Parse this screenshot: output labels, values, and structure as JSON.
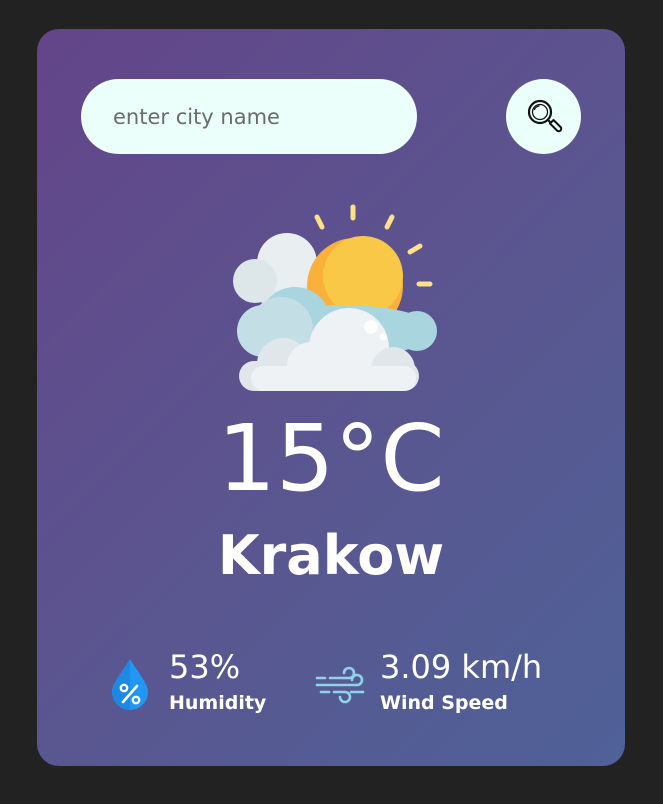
{
  "search": {
    "placeholder": "enter city name",
    "value": "",
    "button_icon": "magnifier-icon"
  },
  "weather": {
    "icon": "partly-cloudy-icon",
    "temperature": "15°C",
    "city": "Krakow"
  },
  "details": {
    "humidity": {
      "icon": "humidity-drop-icon",
      "value": "53%",
      "label": "Humidity"
    },
    "wind": {
      "icon": "wind-icon",
      "value": "3.09 km/h",
      "label": "Wind Speed"
    }
  },
  "colors": {
    "page_background": "#222222",
    "card_gradient_start": "#634589",
    "card_gradient_end": "#4f6198",
    "search_background": "#ebfffb",
    "text": "#ffffff",
    "sun": "#fbb03b",
    "humidity_icon": "#2196f3"
  }
}
